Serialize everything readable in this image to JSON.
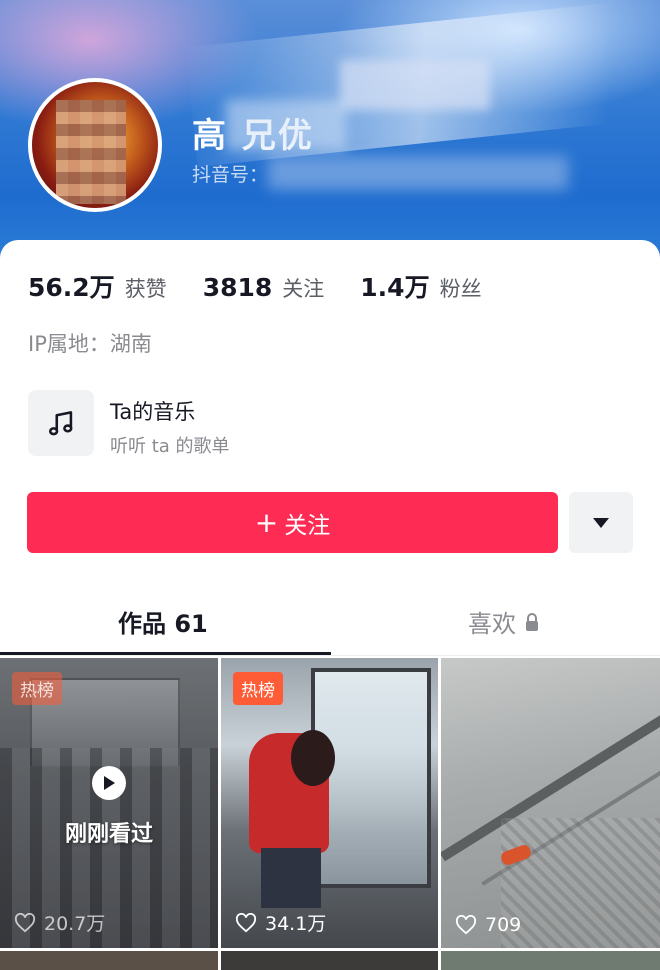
{
  "profile": {
    "name": "高   兄优",
    "douyin_id_label": "抖音号："
  },
  "stats": [
    {
      "value": "56.2万",
      "label": "获赞"
    },
    {
      "value": "3818",
      "label": "关注"
    },
    {
      "value": "1.4万",
      "label": "粉丝"
    }
  ],
  "ip_location": "IP属地：湖南",
  "music": {
    "title": "Ta的音乐",
    "subtitle": "听听 ta 的歌单",
    "icon": "music-note-icon"
  },
  "actions": {
    "follow_plus": "+",
    "follow_label": "关注",
    "more_icon": "caret-down-icon"
  },
  "tabs": {
    "works": "作品 61",
    "likes": "喜欢",
    "likes_icon": "lock-icon"
  },
  "videos": [
    {
      "badge": "热榜",
      "likes": "20.7万",
      "overlay": "刚刚看过",
      "overlay_icon": "play-icon"
    },
    {
      "badge": "热榜",
      "likes": "34.1万"
    },
    {
      "likes": "709"
    }
  ],
  "colors": {
    "accent": "#fe2c55",
    "hot_badge": "#fe5b37",
    "banner": "#2f79d3"
  }
}
